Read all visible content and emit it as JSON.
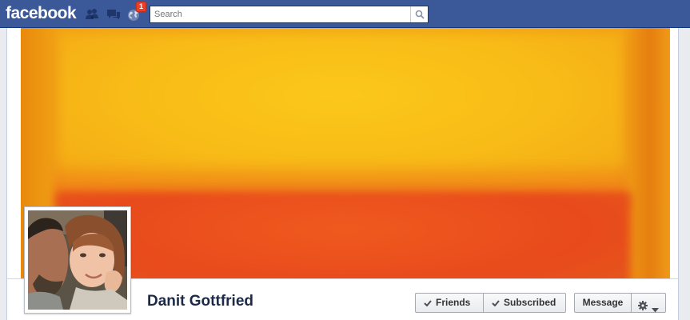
{
  "topbar": {
    "logo": "facebook",
    "notifications_count": "1",
    "search_placeholder": "Search",
    "brand_color": "#3b5998",
    "icons": [
      "friend-requests-icon",
      "messages-icon",
      "notifications-globe-icon",
      "search-icon"
    ]
  },
  "profile": {
    "name": "Danit Gottfried"
  },
  "actions": {
    "friends_label": "Friends",
    "subscribed_label": "Subscribed",
    "message_label": "Message"
  },
  "colors": {
    "cover_yellow": "#fcc81a",
    "cover_red": "#e84a1c",
    "notification_badge": "#f03d25"
  }
}
